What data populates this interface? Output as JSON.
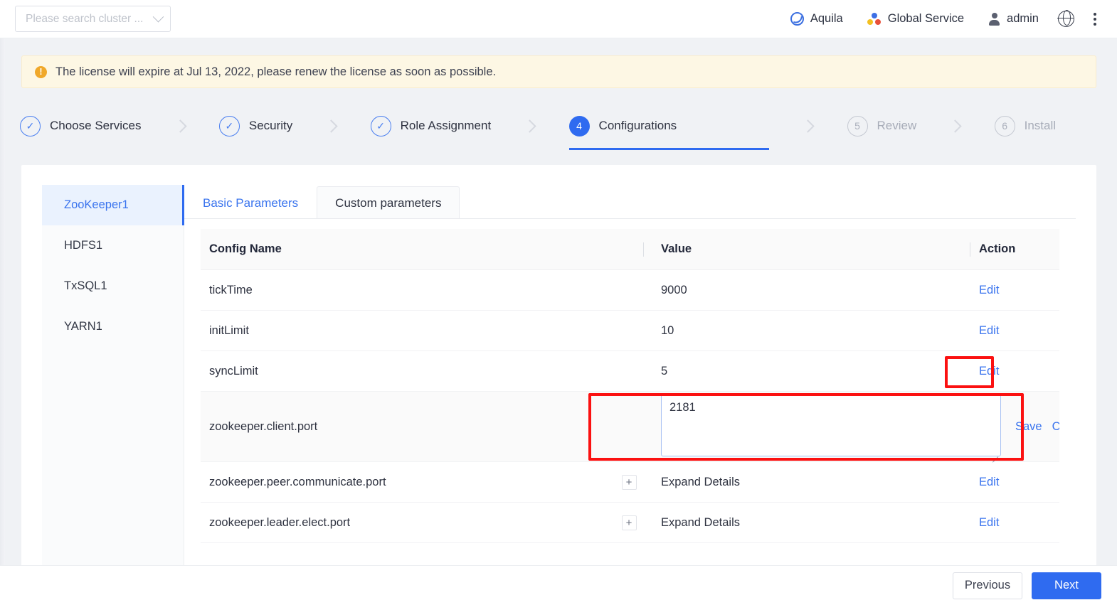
{
  "topbar": {
    "cluster_search_placeholder": "Please search cluster ...",
    "chevron_icon": "chevron-down-icon",
    "items": [
      {
        "label": "Aquila",
        "icon": "aquila-icon"
      },
      {
        "label": "Global Service",
        "icon": "global-service-icon"
      },
      {
        "label": "admin",
        "icon": "user-icon"
      }
    ],
    "globe_icon": "globe-icon",
    "more_icon": "kebab-menu-icon"
  },
  "license_banner": {
    "icon": "warning-icon",
    "text": "The license will expire at Jul 13, 2022, please renew the license as soon as possible."
  },
  "stepper": {
    "steps": [
      {
        "label": "Choose Services",
        "state": "done",
        "marker": "✓"
      },
      {
        "label": "Security",
        "state": "done",
        "marker": "✓"
      },
      {
        "label": "Role Assignment",
        "state": "done",
        "marker": "✓"
      },
      {
        "label": "Configurations",
        "state": "active",
        "marker": "4"
      },
      {
        "label": "Review",
        "state": "todo",
        "marker": "5"
      },
      {
        "label": "Install",
        "state": "todo",
        "marker": "6"
      }
    ]
  },
  "services": {
    "items": [
      {
        "label": "ZooKeeper1",
        "active": true
      },
      {
        "label": "HDFS1",
        "active": false
      },
      {
        "label": "TxSQL1",
        "active": false
      },
      {
        "label": "YARN1",
        "active": false
      }
    ]
  },
  "tabs": [
    {
      "label": "Basic Parameters",
      "active": true
    },
    {
      "label": "Custom parameters",
      "active": false
    }
  ],
  "table": {
    "headers": {
      "config_name": "Config Name",
      "value": "Value",
      "action": "Action"
    },
    "rows": [
      {
        "name": "tickTime",
        "value": "9000",
        "action": "Edit",
        "expandable": false,
        "editing": false
      },
      {
        "name": "initLimit",
        "value": "10",
        "action": "Edit",
        "expandable": false,
        "editing": false
      },
      {
        "name": "syncLimit",
        "value": "5",
        "action": "Edit",
        "expandable": false,
        "editing": false
      },
      {
        "name": "zookeeper.client.port",
        "value": "2181",
        "action": "",
        "expandable": false,
        "editing": true
      },
      {
        "name": "zookeeper.peer.communicate.port",
        "value": "Expand Details",
        "action": "Edit",
        "expandable": true,
        "expand_icon": "plus-icon",
        "editing": false
      },
      {
        "name": "zookeeper.leader.elect.port",
        "value": "Expand Details",
        "action": "Edit",
        "expandable": true,
        "expand_icon": "plus-icon",
        "editing": false
      }
    ],
    "edit_row": {
      "textarea_value": "2181",
      "save_label": "Save",
      "cancel_label": "Cancel",
      "resize_grip_icon": "resize-grip-icon"
    }
  },
  "footer": {
    "previous_label": "Previous",
    "next_label": "Next"
  },
  "colors": {
    "accent": "#2f6bf0",
    "link": "#3a74ee",
    "annotation": "#fb1111",
    "warning_bg": "#fdf7e4",
    "warning_icon": "#f0a82a"
  }
}
